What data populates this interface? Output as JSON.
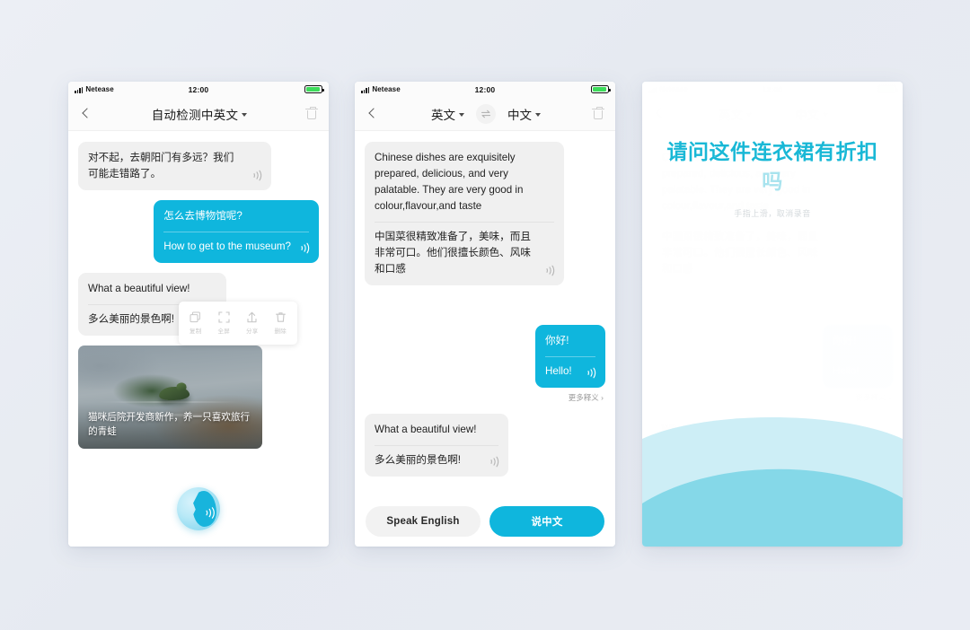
{
  "statusbar": {
    "carrier": "Netease",
    "time": "12:00"
  },
  "phone1": {
    "nav": {
      "title": "自动检测中英文",
      "back_icon": "chevron-left-icon",
      "trash_icon": "trash-icon",
      "caret_icon": "chevron-down-icon"
    },
    "messages": [
      {
        "side": "left",
        "style": "gray",
        "line_a": "对不起，去朝阳门有多远？我们可能走错路了。",
        "line_b": "",
        "speaker_icon": "speaker-icon"
      },
      {
        "side": "right",
        "style": "blue",
        "line_a": "怎么去博物馆呢?",
        "line_b": "How to get to the museum?",
        "speaker_icon": "speaker-icon"
      },
      {
        "side": "left",
        "style": "gray",
        "line_a": "What a beautiful view!",
        "line_b": "多么美丽的景色啊!",
        "speaker_icon": "speaker-icon"
      }
    ],
    "context_menu": [
      {
        "icon": "copy-icon",
        "label": "复制"
      },
      {
        "icon": "fullscreen-icon",
        "label": "全屏"
      },
      {
        "icon": "share-icon",
        "label": "分享"
      },
      {
        "icon": "trash-icon",
        "label": "删除"
      }
    ],
    "image_card": {
      "caption": "猫咪后院开发商新作，养一只喜欢旅行的青蛙"
    },
    "mic_button": {
      "icon": "speaking-face-icon"
    }
  },
  "phone2": {
    "nav": {
      "source_language": "英文",
      "target_language": "中文",
      "swap_icon": "swap-horizontal-icon",
      "back_icon": "chevron-left-icon",
      "trash_icon": "trash-icon"
    },
    "messages": [
      {
        "side": "left",
        "style": "gray",
        "line_a": "Chinese dishes are exquisitely prepared, delicious, and very palatable. They are very good in colour,flavour,and taste",
        "line_b": "中国菜很精致准备了，美味，而且非常可口。他们很擅长颜色、风味和口感",
        "speaker_icon": "speaker-icon"
      },
      {
        "side": "right",
        "style": "blue",
        "line_a": "你好!",
        "line_b": "Hello!",
        "speaker_icon": "speaker-icon"
      },
      {
        "side": "left",
        "style": "gray",
        "line_a": "What a beautiful view!",
        "line_b": "多么美丽的景色啊!",
        "speaker_icon": "speaker-icon"
      }
    ],
    "more_link": "更多释义 ›",
    "footer": {
      "left_button": "Speak English",
      "right_button": "说中文"
    }
  },
  "phone3": {
    "recognized_spoken": "请问这件连衣裙有折扣",
    "recognized_pending": "吗",
    "hint": "手指上滑，取消录音"
  },
  "colors": {
    "accent_cyan": "#0fb6dd",
    "recording_text": "#19b8d6",
    "recording_pending": "#a8e3ee",
    "bubble_gray": "#f0f0f0",
    "page_background": "#e9ecf3",
    "wave_light": "#cceef5",
    "wave_dark": "#86d9e8"
  }
}
